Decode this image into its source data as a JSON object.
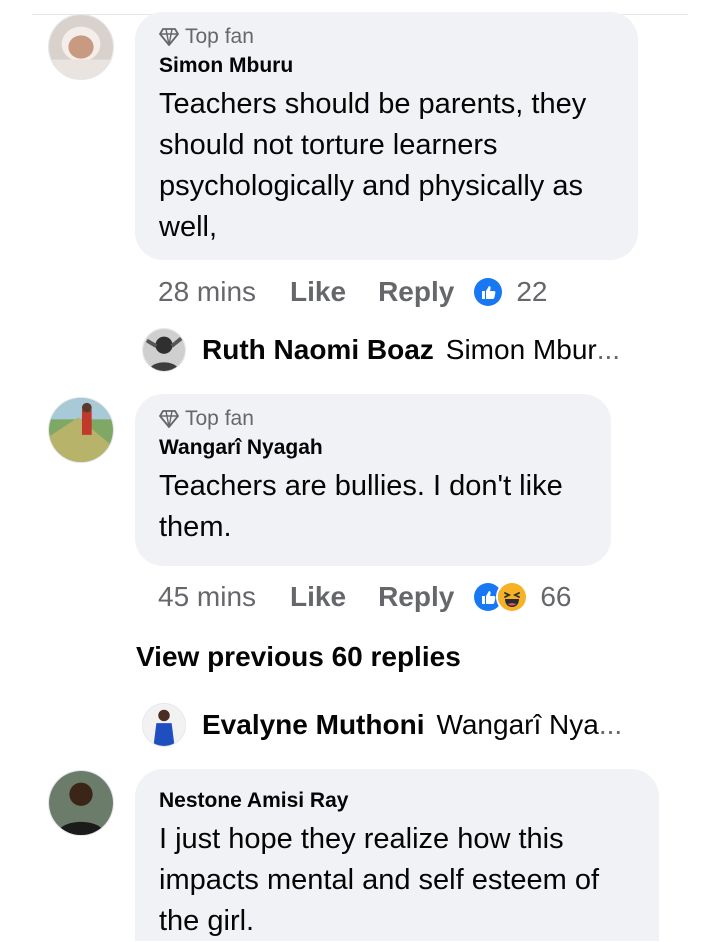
{
  "comments": [
    {
      "badge": "Top fan",
      "author": "Simon Mburu",
      "text": "Teachers should be parents, they should not torture learners psychologically and physically as well,",
      "time": "28 mins",
      "like_label": "Like",
      "reply_label": "Reply",
      "reaction_count": "22",
      "reactions": [
        "like-icon"
      ]
    },
    {
      "badge": "Top fan",
      "author": "Wangarî Nyagah",
      "text": "Teachers are bullies. I don't like them.",
      "time": "45 mins",
      "like_label": "Like",
      "reply_label": "Reply",
      "reaction_count": "66",
      "reactions": [
        "like-icon",
        "haha-icon"
      ]
    },
    {
      "author": "Nestone Amisi Ray",
      "text": "I just hope they  realize how  this impacts mental and self esteem of the girl."
    }
  ],
  "replies": [
    {
      "name": "Ruth Naomi Boaz",
      "snippet": "Simon Mbur",
      "ellipsis": "..."
    },
    {
      "name": "Evalyne Muthoni",
      "snippet": "Wangarî Nya",
      "ellipsis": "..."
    }
  ],
  "view_previous": "View previous 60 replies",
  "colors": {
    "bubble": "#f0f2f5",
    "secondary_text": "#65676b",
    "like_blue": "#1877f2",
    "haha_yellow": "#f7b125"
  }
}
